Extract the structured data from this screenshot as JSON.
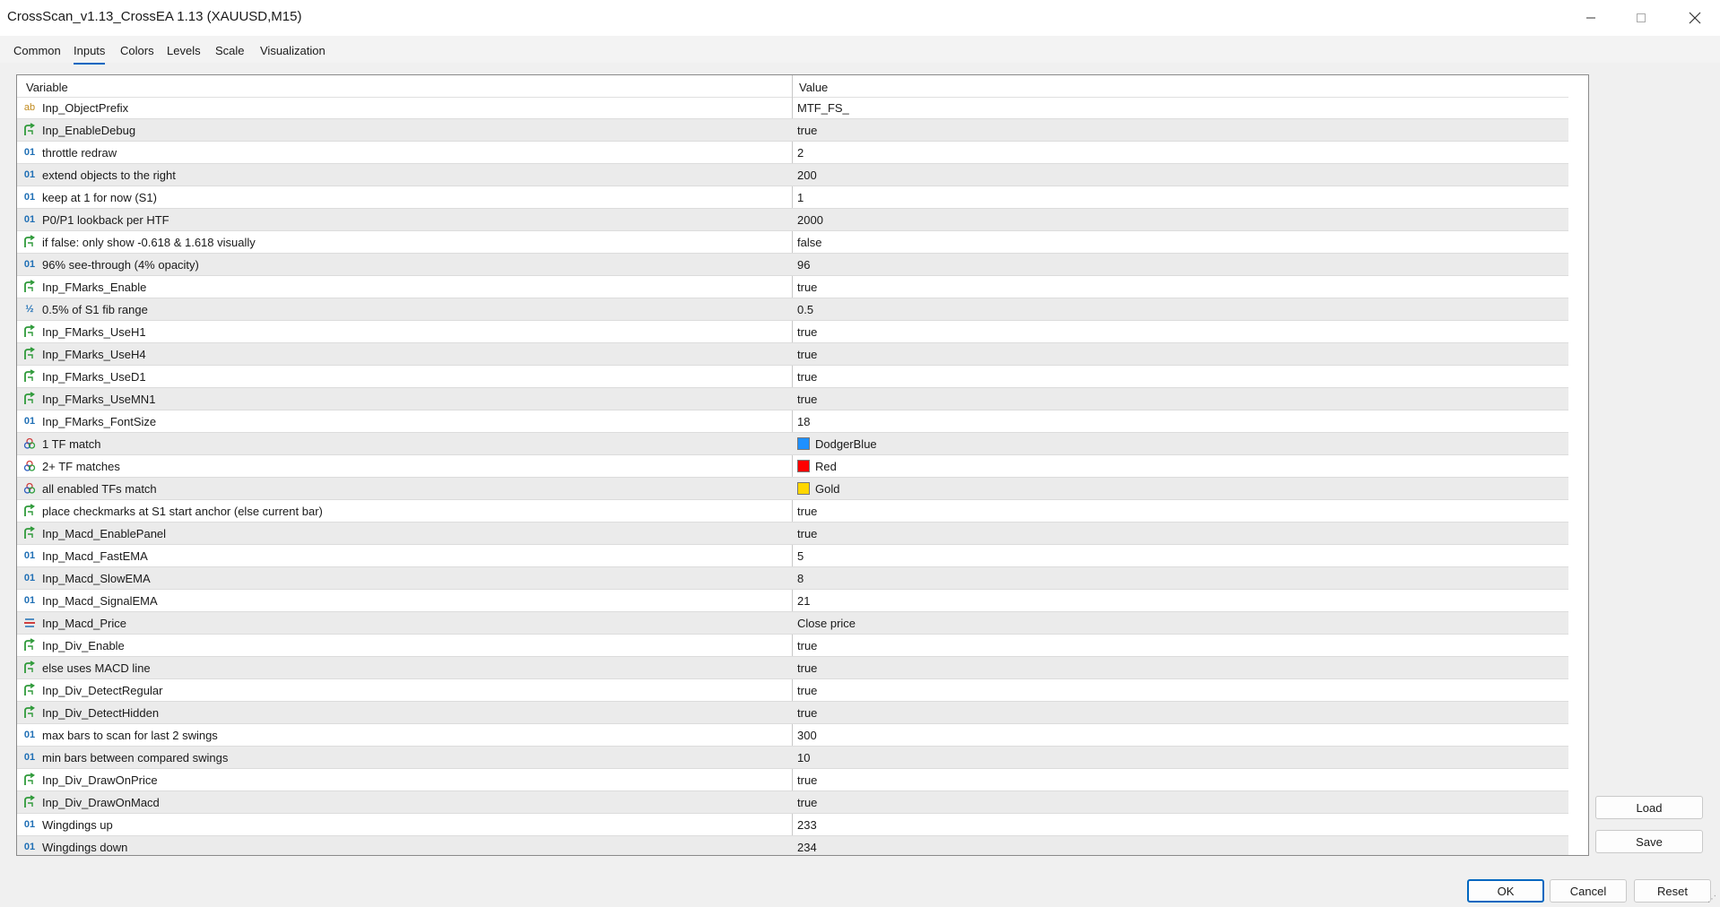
{
  "window": {
    "title": "CrossScan_v1.13_CrossEA 1.13 (XAUUSD,M15)",
    "minimize_icon": "minimize-icon",
    "maximize_icon": "maximize-icon",
    "close_icon": "close-icon"
  },
  "tabs": [
    {
      "label": "Common"
    },
    {
      "label": "Inputs",
      "active": true
    },
    {
      "label": "Colors"
    },
    {
      "label": "Levels"
    },
    {
      "label": "Scale"
    },
    {
      "label": "Visualization"
    }
  ],
  "grid": {
    "header_variable": "Variable",
    "header_value": "Value",
    "rows": [
      {
        "icon": "string",
        "variable": "Inp_ObjectPrefix",
        "value": "MTF_FS_"
      },
      {
        "icon": "bool",
        "variable": "Inp_EnableDebug",
        "value": "true"
      },
      {
        "icon": "int",
        "variable": "throttle redraw",
        "value": "2"
      },
      {
        "icon": "int",
        "variable": "extend objects to the right",
        "value": "200"
      },
      {
        "icon": "int",
        "variable": "keep at 1 for now (S1)",
        "value": "1"
      },
      {
        "icon": "int",
        "variable": "P0/P1 lookback per HTF",
        "value": "2000"
      },
      {
        "icon": "bool",
        "variable": "if false: only show -0.618 & 1.618 visually",
        "value": "false"
      },
      {
        "icon": "int",
        "variable": "96% see-through (4% opacity)",
        "value": "96"
      },
      {
        "icon": "bool",
        "variable": "Inp_FMarks_Enable",
        "value": "true"
      },
      {
        "icon": "double",
        "variable": "0.5% of S1 fib range",
        "value": "0.5"
      },
      {
        "icon": "bool",
        "variable": "Inp_FMarks_UseH1",
        "value": "true"
      },
      {
        "icon": "bool",
        "variable": "Inp_FMarks_UseH4",
        "value": "true"
      },
      {
        "icon": "bool",
        "variable": "Inp_FMarks_UseD1",
        "value": "true"
      },
      {
        "icon": "bool",
        "variable": "Inp_FMarks_UseMN1",
        "value": "true"
      },
      {
        "icon": "int",
        "variable": "Inp_FMarks_FontSize",
        "value": "18"
      },
      {
        "icon": "color",
        "variable": "1 TF match",
        "value": "DodgerBlue",
        "color": "#1e90ff"
      },
      {
        "icon": "color",
        "variable": "2+ TF matches",
        "value": "Red",
        "color": "#ff0000"
      },
      {
        "icon": "color",
        "variable": "all enabled TFs match",
        "value": "Gold",
        "color": "#ffd700"
      },
      {
        "icon": "bool",
        "variable": "place checkmarks at S1 start anchor (else current bar)",
        "value": "true"
      },
      {
        "icon": "bool",
        "variable": "Inp_Macd_EnablePanel",
        "value": "true"
      },
      {
        "icon": "int",
        "variable": "Inp_Macd_FastEMA",
        "value": "5"
      },
      {
        "icon": "int",
        "variable": "Inp_Macd_SlowEMA",
        "value": "8"
      },
      {
        "icon": "int",
        "variable": "Inp_Macd_SignalEMA",
        "value": "21"
      },
      {
        "icon": "enum",
        "variable": "Inp_Macd_Price",
        "value": "Close price"
      },
      {
        "icon": "bool",
        "variable": "Inp_Div_Enable",
        "value": "true"
      },
      {
        "icon": "bool",
        "variable": "else uses MACD line",
        "value": "true"
      },
      {
        "icon": "bool",
        "variable": "Inp_Div_DetectRegular",
        "value": "true"
      },
      {
        "icon": "bool",
        "variable": "Inp_Div_DetectHidden",
        "value": "true"
      },
      {
        "icon": "int",
        "variable": "max bars to scan for last 2 swings",
        "value": "300"
      },
      {
        "icon": "int",
        "variable": "min bars between compared swings",
        "value": "10"
      },
      {
        "icon": "bool",
        "variable": "Inp_Div_DrawOnPrice",
        "value": "true"
      },
      {
        "icon": "bool",
        "variable": "Inp_Div_DrawOnMacd",
        "value": "true"
      },
      {
        "icon": "int",
        "variable": "Wingdings up",
        "value": "233"
      },
      {
        "icon": "int",
        "variable": "Wingdings down",
        "value": "234"
      }
    ]
  },
  "side_buttons": {
    "load": "Load",
    "save": "Save"
  },
  "footer_buttons": {
    "ok": "OK",
    "cancel": "Cancel",
    "reset": "Reset"
  },
  "icon_glyphs": {
    "string": "ab",
    "int": "01",
    "double": "½"
  },
  "icon_colors": {
    "string": "#c08a1e",
    "bool": "#2f9a3a",
    "int": "#1f6fb5",
    "double": "#1f6fb5",
    "color": "#6a4ab0",
    "enum": "#1f6fb5"
  }
}
